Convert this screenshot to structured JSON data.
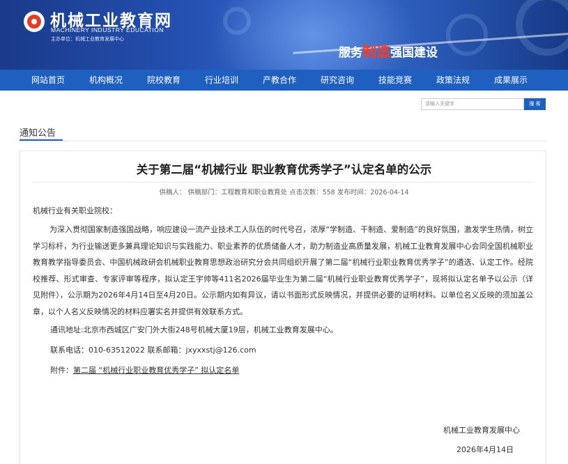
{
  "header": {
    "logo_cn": "机械工业教育网",
    "logo_en": "MACHINERY INDUSTRY EDUCATION",
    "host": "主办单位：机械工业教育发展中心",
    "slogan_pre": "服务",
    "slogan_hl": "制造",
    "slogan_post": "强国建设"
  },
  "nav": {
    "items": [
      "网站首页",
      "机构概况",
      "院校教育",
      "行业培训",
      "产教合作",
      "研究咨询",
      "技能竞赛",
      "政策法规",
      "成果展示"
    ]
  },
  "search": {
    "placeholder": "请输入关键字",
    "button": "搜 索"
  },
  "section": {
    "title": "通知公告"
  },
  "article": {
    "title": "关于第二届“机械行业 职业教育优秀学子”认定名单的公示",
    "meta": "供稿人：  供稿部门：工程教育和职业教育处   点击次数：558   发布时间：2026-04-14",
    "salutation": "机械行业有关职业院校：",
    "paragraph": "为深入贯彻国家制造强国战略，响应建设一流产业技术工人队伍的时代号召，浓厚“学制造、干制造、爱制造”的良好氛围，激发学生热情，树立学习标杆，为行业输送更多兼具理论知识与实践能力、职业素养的优质储备人才，助力制造业高质量发展，机械工业教育发展中心会同全国机械职业教育教学指导委员会、中国机械政研会机械职业教育思想政治研究分会共同组织开展了第二届“机械行业职业教育优秀学子”的遴选、认定工作。经院校推荐、形式审查、专家评审等程序，拟认定王宇帅等411名2026届毕业生为第二届“机械行业职业教育优秀学子”，现将拟认定名单予以公示（详见附件），公示期为2026年4月14日至4月20日。公示期内如有异议，请以书面形式反映情况，并提供必要的证明材料。以单位名义反映的须加盖公章，以个人名义反映情况的材料应署实名并提供有效联系方式。",
    "address": "通讯地址:北京市西城区广安门外大街248号机械大厦19层，机械工业教育发展中心。",
    "contact": "联系电话：010-63512022  联系邮箱：jxyxxstj@126.com",
    "attachment_label": "附件：",
    "attachment_link": "第二届 “机械行业职业教育优秀学子” 拟认定名单",
    "sign_org": "机械工业教育发展中心",
    "sign_date": "2026年4月14日"
  }
}
